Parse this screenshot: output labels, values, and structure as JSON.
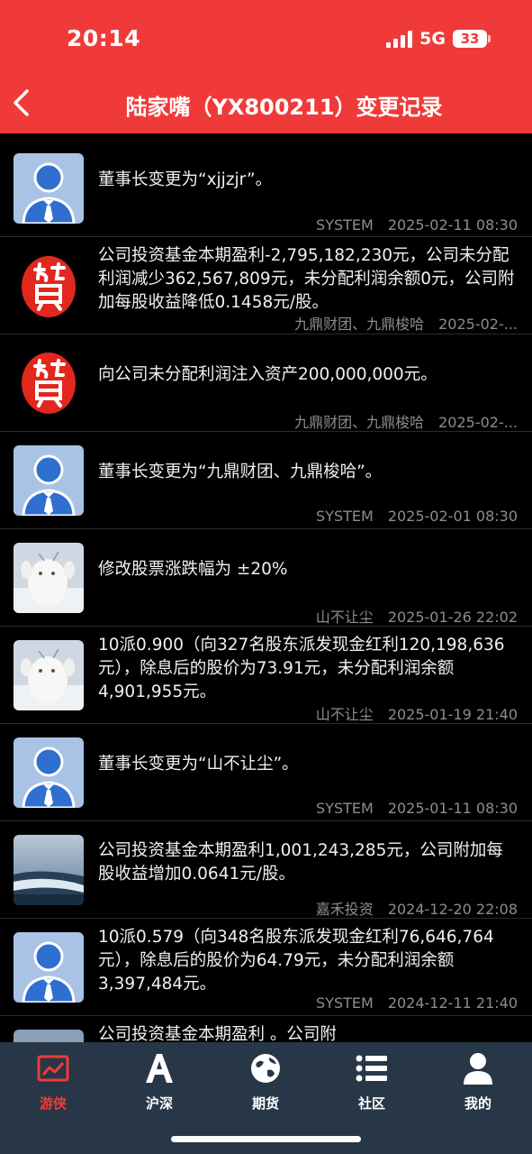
{
  "status_bar": {
    "time": "20:14",
    "network": "5G",
    "battery": "33"
  },
  "header": {
    "title": "陆家嘴（YX800211）变更记录"
  },
  "records": [
    {
      "avatar": "default-avatar",
      "text": "董事长变更为“xjjzjr”。",
      "who": "SYSTEM",
      "time": "2025-02-11 08:30"
    },
    {
      "avatar": "jiuding-seal",
      "text": "公司投资基金本期盈利-2,795,182,230元，公司未分配利润减少362,567,809元，未分配利润余额0元，公司附加每股收益降低0.1458元/股。",
      "who": "九鼎财团、九鼎梭哈",
      "time": "2025-02-..."
    },
    {
      "avatar": "jiuding-seal",
      "text": "向公司未分配利润注入资产200,000,000元。",
      "who": "九鼎财团、九鼎梭哈",
      "time": "2025-02-..."
    },
    {
      "avatar": "default-avatar",
      "text": "董事长变更为“九鼎财团、九鼎梭哈”。",
      "who": "SYSTEM",
      "time": "2025-02-01 08:30"
    },
    {
      "avatar": "white-cat-photo",
      "text": "修改股票涨跌幅为 ±20%",
      "who": "山不让尘",
      "time": "2025-01-26 22:02"
    },
    {
      "avatar": "white-cat-photo",
      "text": "10派0.900（向327名股东派发现金红利120,198,636元），除息后的股价为73.91元，未分配利润余额4,901,955元。",
      "who": "山不让尘",
      "time": "2025-01-19 21:40"
    },
    {
      "avatar": "default-avatar",
      "text": "董事长变更为“山不让尘”。",
      "who": "SYSTEM",
      "time": "2025-01-11 08:30"
    },
    {
      "avatar": "beach-photo",
      "text": "公司投资基金本期盈利1,001,243,285元，公司附加每股收益增加0.0641元/股。",
      "who": "嘉禾投资",
      "time": "2024-12-20 22:08"
    },
    {
      "avatar": "default-avatar",
      "text": "10派0.579（向348名股东派发现金红利76,646,764元），除息后的股价为64.79元，未分配利润余额3,397,484元。",
      "who": "SYSTEM",
      "time": "2024-12-11 21:40"
    },
    {
      "avatar": "beach-photo",
      "text": "公司投资基金本期盈利 。公司附",
      "who": "",
      "time": ""
    }
  ],
  "tabbar": {
    "items": [
      {
        "label": "游侠",
        "icon": "trend-chart-icon",
        "active": true
      },
      {
        "label": "沪深",
        "icon": "letter-a-icon",
        "active": false
      },
      {
        "label": "期货",
        "icon": "globe-icon",
        "active": false
      },
      {
        "label": "社区",
        "icon": "list-icon",
        "active": false
      },
      {
        "label": "我的",
        "icon": "person-icon",
        "active": false
      }
    ]
  },
  "colors": {
    "accent": "#f03a3a",
    "tabbar_bg": "#283747",
    "meta_text": "#8d8d8d",
    "row_divider": "#2a2a2a"
  }
}
